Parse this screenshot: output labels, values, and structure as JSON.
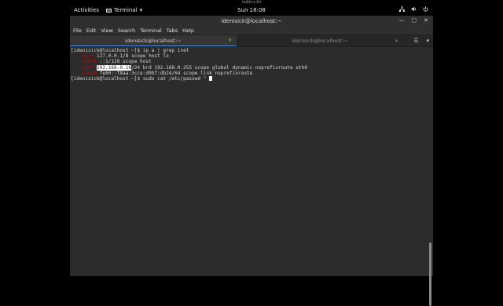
{
  "titlebar_hint": "hsl28 on EH",
  "topbar": {
    "activities": "Activities",
    "app_menu": "Terminal",
    "app_menu_arrow": "▾",
    "clock": "Sun 18:08",
    "status_icons": [
      "network-icon",
      "volume-icon",
      "power-icon"
    ]
  },
  "window": {
    "title": "idenisick@localhost:~",
    "minimize": "—",
    "maximize": "▢",
    "close": "✕"
  },
  "menubar": [
    "File",
    "Edit",
    "View",
    "Search",
    "Terminal",
    "Tabs",
    "Help"
  ],
  "tabs": [
    {
      "label": "idenisick@localhost:~",
      "active": true,
      "close": "✕"
    },
    {
      "label": "idenisick@localhost:~",
      "active": false,
      "close": "✕"
    }
  ],
  "tab_actions": {
    "new_tab": "⎘",
    "menu": "▾"
  },
  "terminal": {
    "prompt": "[idenisick@localhost ~]$",
    "cmd1": " ip a | grep inet",
    "l1_pre": "    ",
    "l1_kw": "inet",
    "l1_rest": " 127.0.0.1/8 scope host lo",
    "l2_kw": "inet6",
    "l2_rest": " ::1/128 scope host",
    "l3_kw": "inet",
    "l3_sel": "192.168.0.18",
    "l3_rest": "/24 brd 192.168.0.255 scope global dynamic noprefixroute eth0",
    "l4_kw": "inet6",
    "l4_rest": " fe80::f8aa:3cce:d0bf:db24/64 scope link noprefixroute",
    "cmd2": " sudo cat /etc/passwd \" "
  }
}
